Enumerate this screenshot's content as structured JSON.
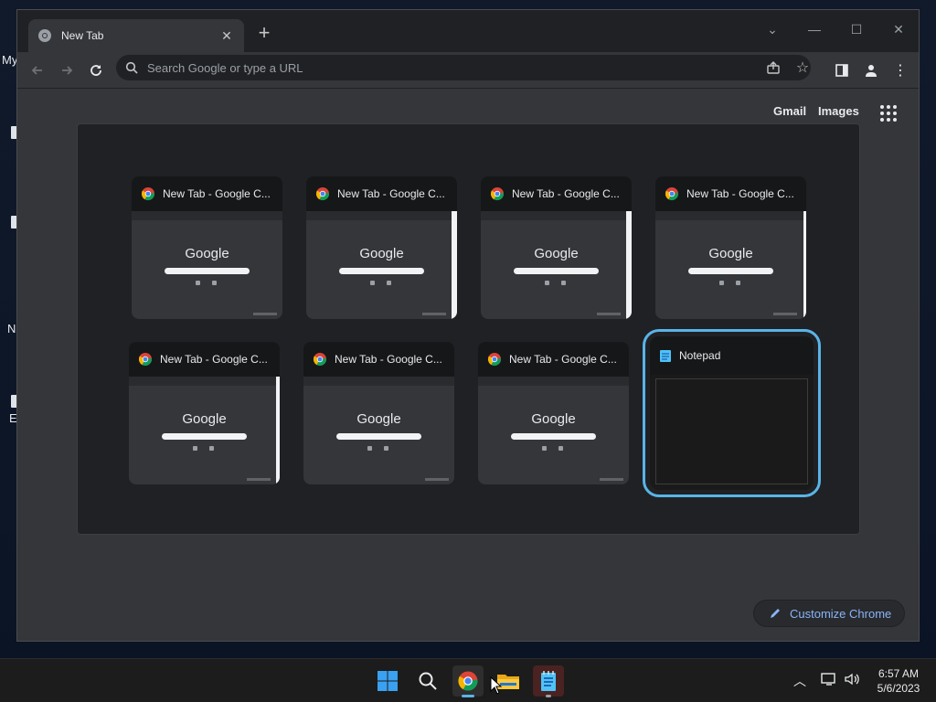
{
  "desktop": {
    "labels": [
      "My",
      "N",
      "E"
    ]
  },
  "browser": {
    "tab_title": "New Tab",
    "new_tab_symbol": "+",
    "omnibox_placeholder": "Search Google or type a URL",
    "top_links": [
      "Gmail",
      "Images"
    ],
    "customize_label": "Customize Chrome"
  },
  "switcher": {
    "windows": [
      {
        "title": "New Tab - Google C...",
        "type": "chrome"
      },
      {
        "title": "New Tab - Google C...",
        "type": "chrome"
      },
      {
        "title": "New Tab - Google C...",
        "type": "chrome"
      },
      {
        "title": "New Tab - Google C...",
        "type": "chrome"
      },
      {
        "title": "New Tab - Google C...",
        "type": "chrome"
      },
      {
        "title": "New Tab - Google C...",
        "type": "chrome"
      },
      {
        "title": "New Tab - Google C...",
        "type": "chrome"
      },
      {
        "title": "Notepad",
        "type": "notepad",
        "selected": true
      }
    ],
    "thumb_logo": "Google"
  },
  "taskbar": {
    "time": "6:57 AM",
    "date": "5/6/2023",
    "apps": [
      "start-icon",
      "search-icon",
      "chrome-icon",
      "file-explorer-icon",
      "notepad-icon"
    ]
  },
  "colors": {
    "accent": "#59b4e8",
    "link": "#8ab4f8"
  }
}
